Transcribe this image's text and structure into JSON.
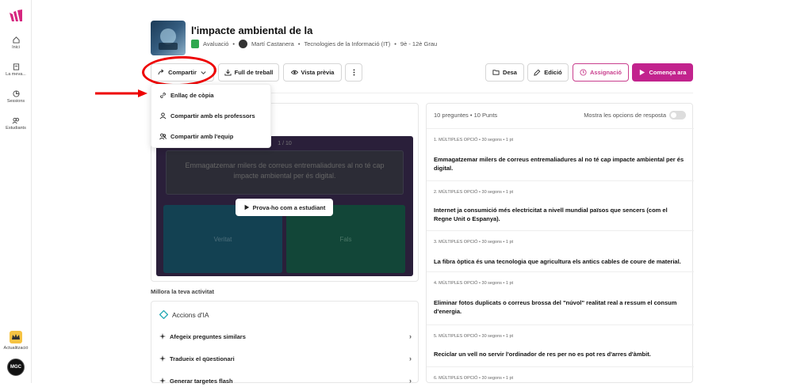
{
  "sidebar": {
    "items": [
      {
        "label": "Inici",
        "icon": "home-icon"
      },
      {
        "label": "La meva...",
        "icon": "library-icon"
      },
      {
        "label": "Sessions",
        "icon": "sessions-icon"
      },
      {
        "label": "Estudiants",
        "icon": "students-icon"
      }
    ],
    "upgrade_label": "Actualització",
    "avatar_text": "MGC"
  },
  "header": {
    "title": "l'impacte ambiental de la",
    "type": "Avaluació",
    "author": "Martí Castanera",
    "subject": "Tecnologies de la Informació (IT)",
    "grade": "9è - 12è Grau"
  },
  "toolbar": {
    "share": "Compartir",
    "worksheet": "Full de treball",
    "preview": "Vista prèvia",
    "save": "Desa",
    "edit": "Edició",
    "assign": "Assignació",
    "start": "Comença ara"
  },
  "share_menu": {
    "items": [
      "Enllaç de còpia",
      "Compartir amb els professors",
      "Compartir amb l'equip"
    ]
  },
  "preview": {
    "counter": "1 / 10",
    "question": "Emmagatzemar milers de correus entremaliadures al no té cap impacte ambiental per és digital.",
    "answer_true": "Veritat",
    "answer_false": "Fals",
    "try_button": "Prova-ho com a estudiant"
  },
  "improve": {
    "heading": "Millora la teva activitat",
    "ai_title": "Accions d'IA",
    "actions": [
      "Afegeix preguntes similars",
      "Tradueix el qüestionari",
      "Generar targetes flash"
    ]
  },
  "questions_panel": {
    "summary": "10 preguntes • 10 Punts",
    "toggle_label": "Mostra les opcions de resposta",
    "questions": [
      {
        "label": "1. MÚLTIPLES OPCIÓ • 30 segons • 1 pt",
        "text": "Emmagatzemar milers de correus entremaliadures al no té cap impacte ambiental per és digital."
      },
      {
        "label": "2. MÚLTIPLES OPCIÓ • 30 segons • 1 pt",
        "text": "Internet ja consumició més electricitat a nivell mundial països que sencers (com el Regne Unit o Espanya)."
      },
      {
        "label": "3. MÚLTIPLES OPCIÓ • 30 segons • 1 pt",
        "text": "La fibra òptica és una tecnologia que agricultura els antics cables de coure de material."
      },
      {
        "label": "4. MÚLTIPLES OPCIÓ • 30 segons • 1 pt",
        "text": "Eliminar fotos duplicats o correus brossa del \"núvol\" realitat real a ressum el consum d'energia."
      },
      {
        "label": "5. MÚLTIPLES OPCIÓ • 30 segons • 1 pt",
        "text": "Reciclar un vell no servir l'ordinador de res per no es pot res d'arres d'àmbit."
      },
      {
        "label": "6. MÚLTIPLES OPCIÓ • 30 segons • 1 pt",
        "text": ""
      }
    ]
  },
  "colors": {
    "accent": "#c2238d",
    "annotation": "#e00000"
  }
}
